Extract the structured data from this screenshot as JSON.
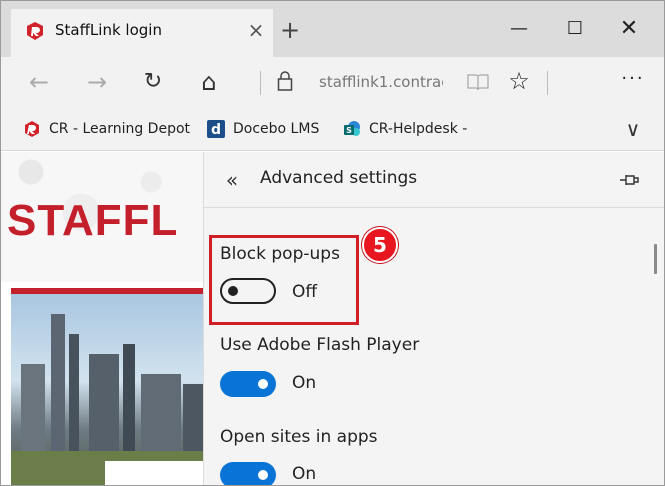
{
  "tab": {
    "title": "StaffLink login",
    "close_glyph": "×",
    "new_tab_glyph": "+",
    "icon": "stafflink-logo-icon"
  },
  "window_controls": {
    "minimize": "—",
    "maximize": "☐",
    "close": "✕"
  },
  "nav": {
    "back": "←",
    "forward": "→",
    "refresh": "↻",
    "home": "⌂",
    "url": "stafflink1.contrac",
    "reading_view": "📖",
    "favorite": "☆",
    "more": "···"
  },
  "favorites": {
    "items": [
      {
        "label": "CR - Learning Depot",
        "icon": "cr-logo-icon"
      },
      {
        "label": "Docebo LMS",
        "icon": "docebo-d-icon"
      },
      {
        "label": "CR-Helpdesk -",
        "icon": "sharepoint-icon"
      }
    ],
    "overflow": "∨"
  },
  "page": {
    "brand_text": "STAFFL"
  },
  "panel": {
    "back_glyph": "«",
    "title": "Advanced settings",
    "settings": [
      {
        "label": "Block pop-ups",
        "state": "Off",
        "on": false
      },
      {
        "label": "Use Adobe Flash Player",
        "state": "On",
        "on": true
      },
      {
        "label": "Open sites in apps",
        "state": "On",
        "on": true
      }
    ],
    "step_badge": "5"
  },
  "colors": {
    "accent_red": "#c4202b",
    "toggle_blue": "#0a74d6",
    "highlight_red": "#d11f26"
  }
}
